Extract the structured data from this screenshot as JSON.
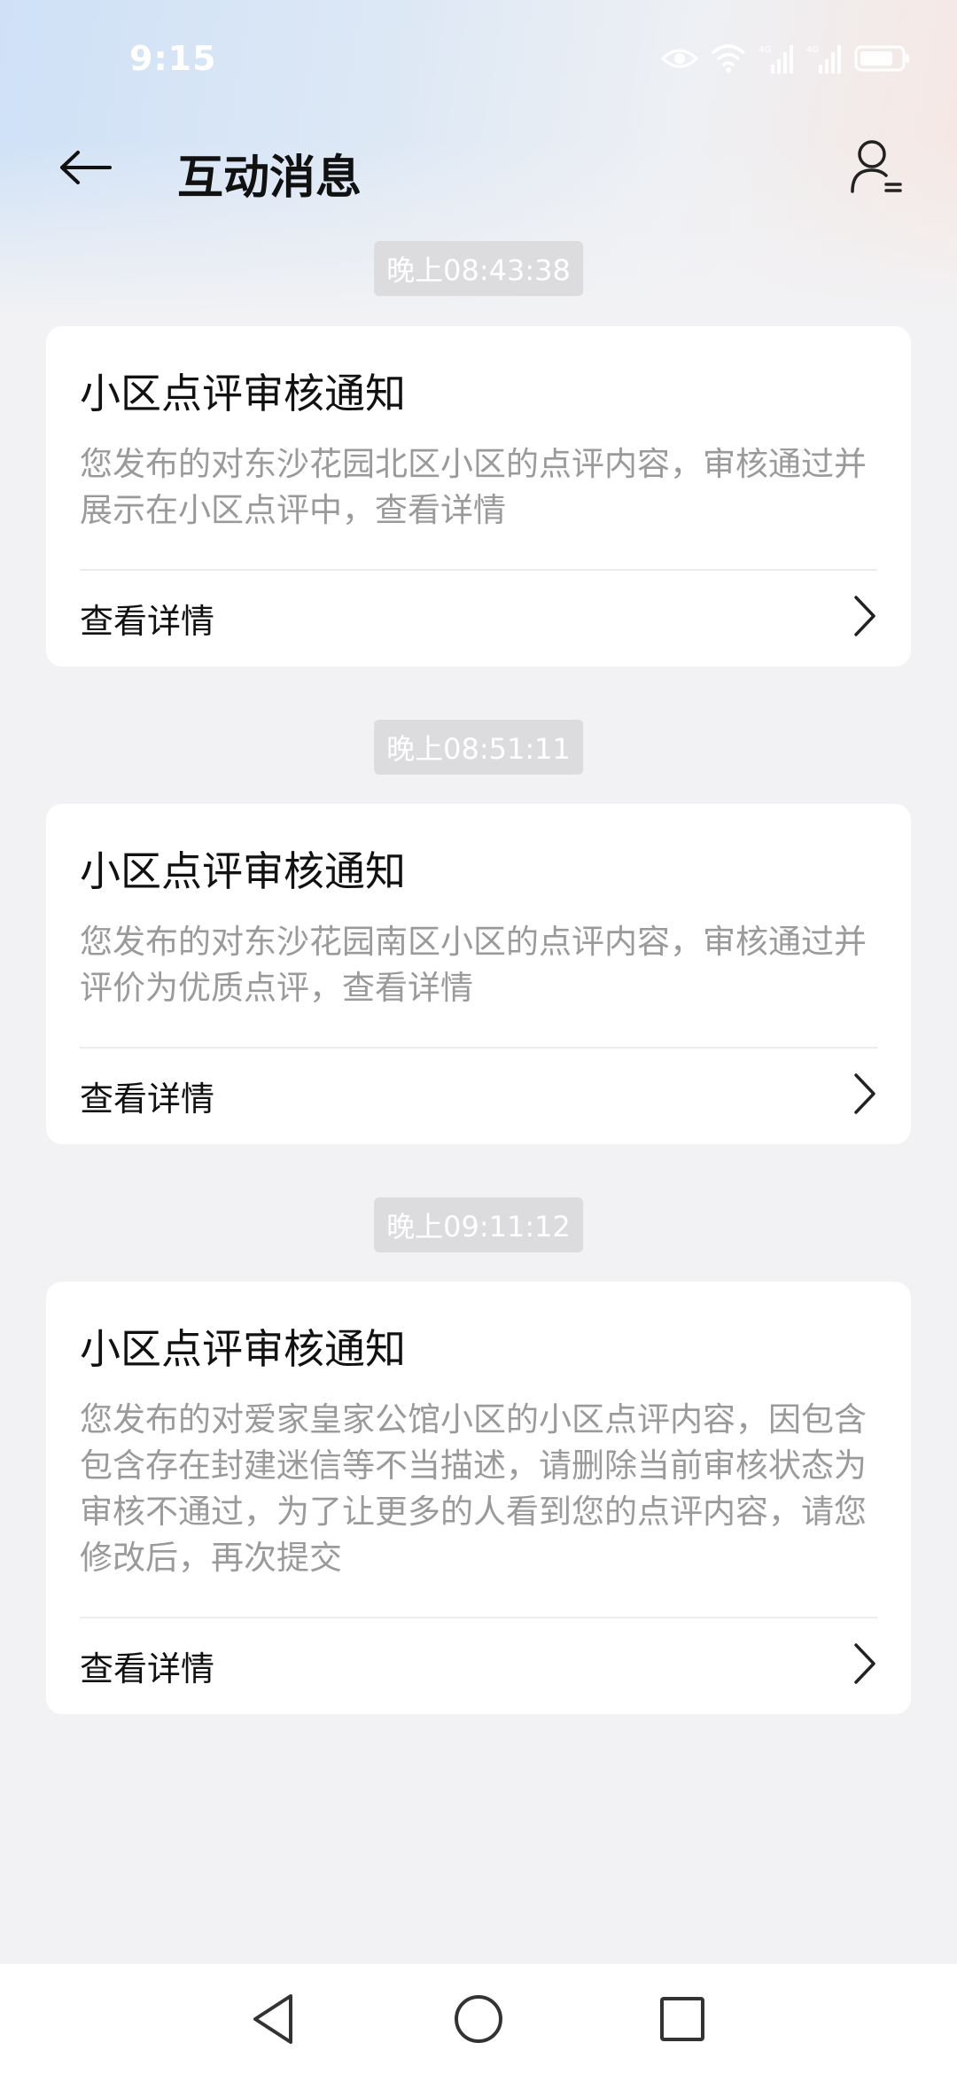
{
  "status_bar": {
    "time": "9:15"
  },
  "header": {
    "title": "互动消息",
    "back_icon": "arrow-left-icon",
    "profile_icon": "user-list-icon"
  },
  "messages": [
    {
      "timestamp": "晚上08:43:38",
      "title": "小区点评审核通知",
      "body": "您发布的对东沙花园北区小区的点评内容，审核通过并展示在小区点评中，查看详情",
      "link_label": "查看详情"
    },
    {
      "timestamp": "晚上08:51:11",
      "title": "小区点评审核通知",
      "body": "您发布的对东沙花园南区小区的点评内容，审核通过并评价为优质点评，查看详情",
      "link_label": "查看详情"
    },
    {
      "timestamp": "晚上09:11:12",
      "title": "小区点评审核通知",
      "body": "您发布的对爱家皇家公馆小区的小区点评内容，因包含包含存在封建迷信等不当描述，请删除当前审核状态为审核不通过，为了让更多的人看到您的点评内容，请您修改后，再次提交",
      "link_label": "查看详情"
    }
  ],
  "colors": {
    "title_text": "#111111",
    "body_text": "#9a9a9a",
    "timestamp_bg": "#dcdcdf",
    "page_bg": "#f2f2f4"
  }
}
